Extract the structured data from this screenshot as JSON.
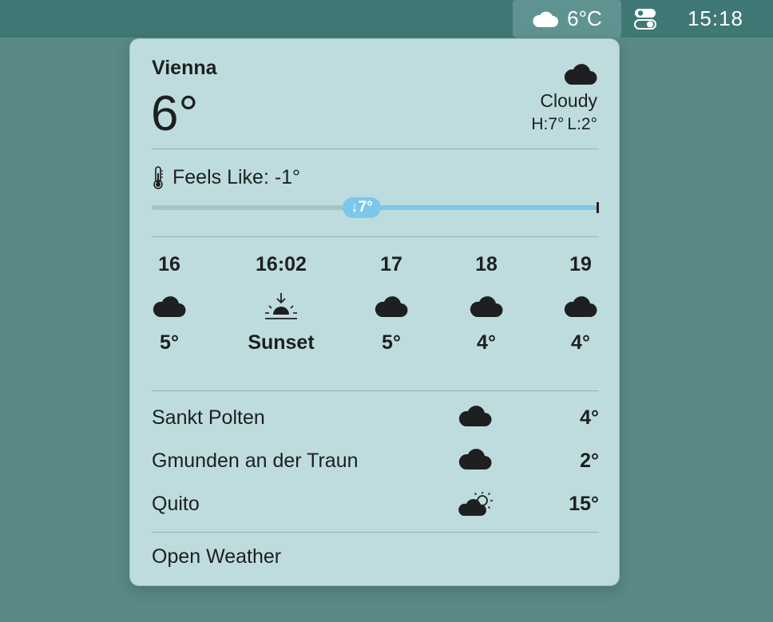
{
  "menubar": {
    "weather_icon": "cloud-icon",
    "weather_temp": "6°C",
    "control_icon": "control-center-icon",
    "clock": "15:18"
  },
  "current": {
    "city": "Vienna",
    "temp": "6°",
    "icon": "cloud-icon",
    "condition": "Cloudy",
    "high": "H:7°",
    "low": "L:2°"
  },
  "feels_like": {
    "icon": "thermometer-icon",
    "label": "Feels Like: -1°",
    "indicator": "↓7°",
    "fill_fraction": 0.43
  },
  "hourly": [
    {
      "label": "16",
      "icon": "cloud-icon",
      "temp": "5°"
    },
    {
      "label": "16:02",
      "icon": "sunset-icon",
      "temp": "Sunset"
    },
    {
      "label": "17",
      "icon": "cloud-icon",
      "temp": "5°"
    },
    {
      "label": "18",
      "icon": "cloud-icon",
      "temp": "4°"
    },
    {
      "label": "19",
      "icon": "cloud-icon",
      "temp": "4°"
    }
  ],
  "locations": [
    {
      "name": "Sankt Polten",
      "icon": "cloud-icon",
      "temp": "4°"
    },
    {
      "name": "Gmunden an der Traun",
      "icon": "cloud-icon",
      "temp": "2°"
    },
    {
      "name": "Quito",
      "icon": "partly-sunny-icon",
      "temp": "15°"
    }
  ],
  "footer": {
    "open_label": "Open Weather"
  },
  "colors": {
    "desktop": "#598a88",
    "menubar": "#3f7775",
    "panel": "#bedcde",
    "accent": "#7cc7ec",
    "text": "#1d1f20"
  }
}
